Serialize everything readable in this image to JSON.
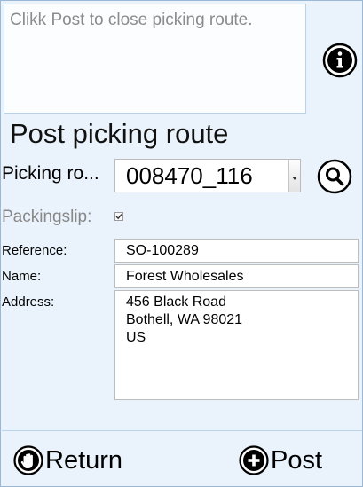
{
  "instruction": {
    "text": "Clikk Post to close picking route."
  },
  "header": {
    "title": "Post picking route"
  },
  "picking_route": {
    "label": "Picking ro...",
    "value": "008470_116"
  },
  "packingslip": {
    "label": "Packingslip:",
    "checked": true
  },
  "fields": {
    "reference_label": "Reference:",
    "reference_value": "SO-100289",
    "name_label": "Name:",
    "name_value": "Forest Wholesales",
    "address_label": "Address:",
    "address_lines": [
      "456 Black Road",
      "Bothell, WA 98021",
      "US"
    ]
  },
  "buttons": {
    "return_label": "Return",
    "post_label": "Post"
  },
  "icons": {
    "info": "info-icon",
    "search": "search-icon",
    "return": "hand-stop-icon",
    "post": "plus-circle-icon",
    "checkbox": "checkmark-icon"
  },
  "colors": {
    "background": "#eaf3fb",
    "border": "#9bb9d6",
    "text": "#000000",
    "muted_text": "#8b8b8b"
  }
}
